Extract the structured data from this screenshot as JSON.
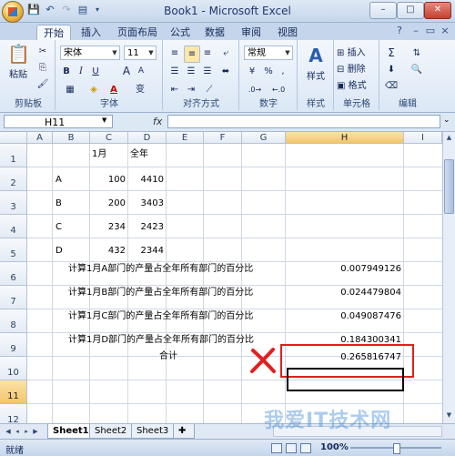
{
  "window": {
    "title": "Book1 - Microsoft Excel",
    "controls": {
      "minimize": "–",
      "maximize": "□",
      "close": "✕"
    }
  },
  "quick_access": {
    "save_icon": "save-icon",
    "undo_icon": "undo-icon",
    "redo_icon": "redo-icon",
    "preview_icon": "print-preview-icon"
  },
  "tabs": [
    "开始",
    "插入",
    "页面布局",
    "公式",
    "数据",
    "审阅",
    "视图"
  ],
  "active_tab": "开始",
  "ribbon": {
    "clipboard": {
      "label": "剪贴板",
      "paste": "粘贴"
    },
    "font": {
      "label": "字体",
      "font_name": "宋体",
      "font_size": "11",
      "bold": "B",
      "italic": "I",
      "underline": "U",
      "grow": "A",
      "shrink": "A",
      "color_a": "A",
      "wen": "变"
    },
    "alignment": {
      "label": "对齐方式"
    },
    "number": {
      "label": "数字",
      "format": "常规",
      "percent": "%",
      "comma": ","
    },
    "styles": {
      "label": "样式",
      "styles_button": "样式"
    },
    "cells": {
      "label": "单元格",
      "insert": "插入",
      "delete": "删除",
      "format": "格式"
    },
    "editing": {
      "label": "编辑",
      "sigma": "Σ"
    }
  },
  "formula_bar": {
    "name_box": "H11",
    "fx": "fx",
    "content": ""
  },
  "columns": [
    "A",
    "B",
    "C",
    "D",
    "E",
    "F",
    "G",
    "H",
    "I"
  ],
  "rows": [
    "1",
    "2",
    "3",
    "4",
    "5",
    "6",
    "7",
    "8",
    "9",
    "10",
    "11",
    "12"
  ],
  "active_cell": "H11",
  "cells": {
    "C1": "1月",
    "D1": "全年",
    "B2": "A",
    "C2": "100",
    "D2": "4410",
    "B3": "B",
    "C3": "200",
    "D3": "3403",
    "B4": "C",
    "C4": "234",
    "D4": "2423",
    "B5": "D",
    "C5": "432",
    "D5": "2344",
    "B6": "计算1月A部门的产量占全年所有部门的百分比",
    "H6": "0.007949126",
    "B7": "计算1月B部门的产量占全年所有部门的百分比",
    "H7": "0.024479804",
    "B8": "计算1月C部门的产量占全年所有部门的百分比",
    "H8": "0.049087476",
    "B9": "计算1月D部门的产量占全年所有部门的百分比",
    "H9": "0.184300341",
    "E10": "合计",
    "H10": "0.265816747"
  },
  "sheets": [
    "Sheet1",
    "Sheet2",
    "Sheet3"
  ],
  "active_sheet": "Sheet1",
  "status": {
    "ready": "就绪",
    "zoom": "100%"
  },
  "watermark": "我爱IT技术网",
  "colors": {
    "annotation_red": "#e02020",
    "header_selected": "#f4c56b"
  }
}
